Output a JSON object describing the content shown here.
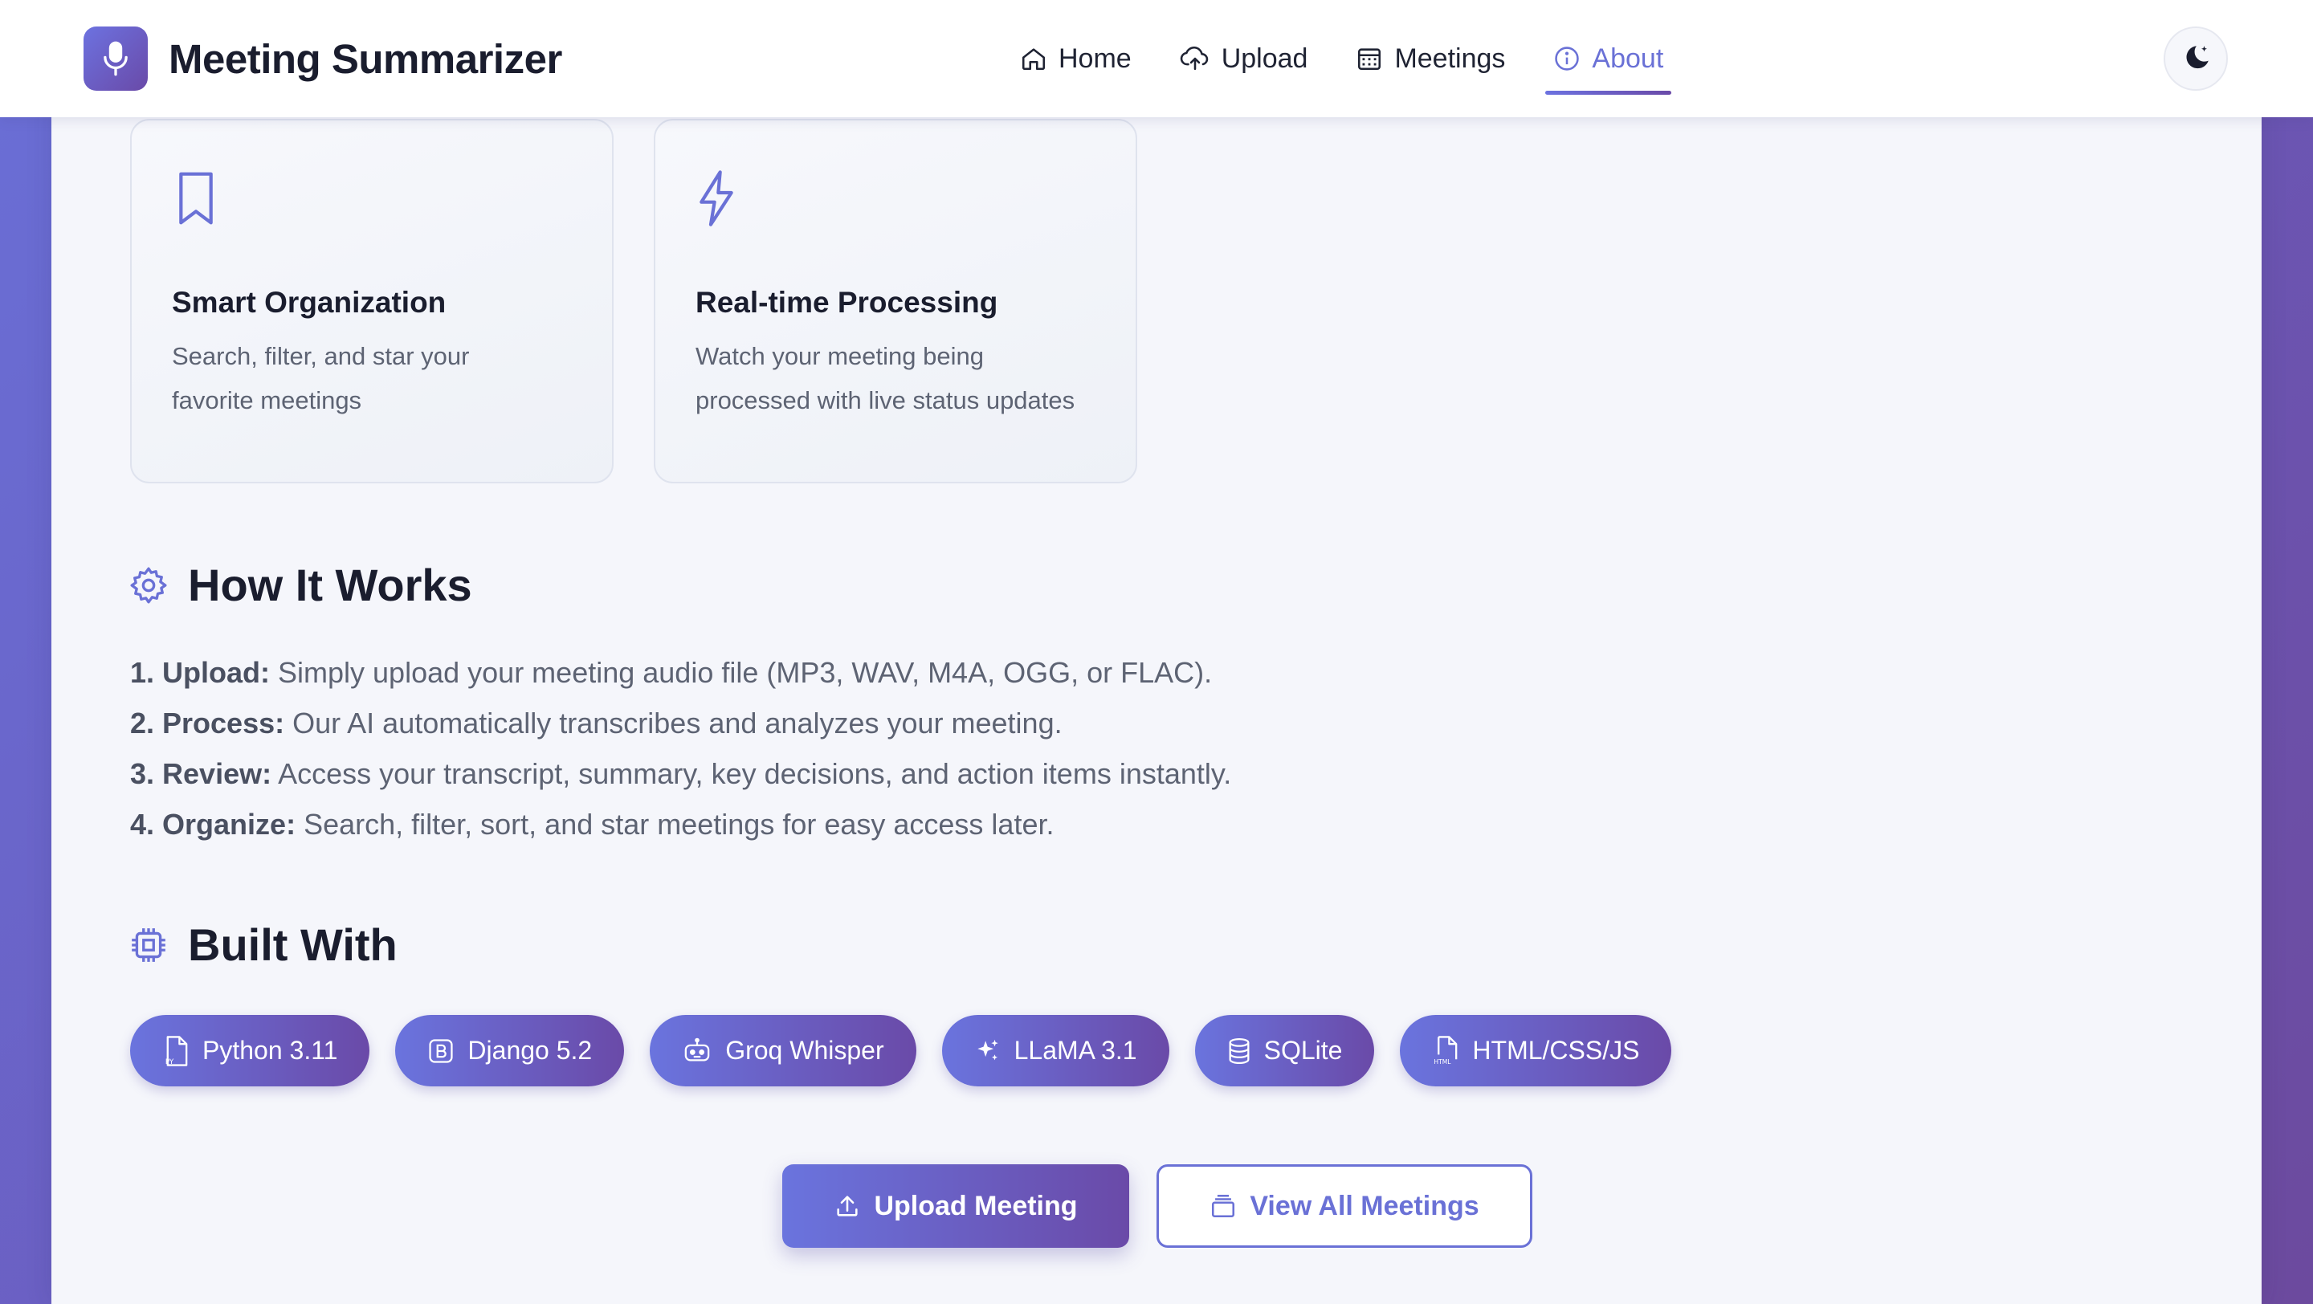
{
  "app": {
    "title": "Meeting Summarizer"
  },
  "nav": {
    "items": [
      {
        "label": "Home",
        "icon": "home-icon"
      },
      {
        "label": "Upload",
        "icon": "cloud-upload-icon"
      },
      {
        "label": "Meetings",
        "icon": "calendar-icon"
      },
      {
        "label": "About",
        "icon": "info-icon",
        "active": true
      }
    ],
    "theme_toggle_icon": "moon-stars-icon"
  },
  "features": [
    {
      "icon": "bookmark-icon",
      "title": "Smart Organization",
      "description": "Search, filter, and star your favorite meetings"
    },
    {
      "icon": "lightning-icon",
      "title": "Real-time Processing",
      "description": "Watch your meeting being processed with live status updates"
    }
  ],
  "how_it_works": {
    "title": "How It Works",
    "icon": "gear-icon",
    "steps": [
      {
        "label": "1. Upload:",
        "text": " Simply upload your meeting audio file (MP3, WAV, M4A, OGG, or FLAC)."
      },
      {
        "label": "2. Process:",
        "text": " Our AI automatically transcribes and analyzes your meeting."
      },
      {
        "label": "3. Review:",
        "text": " Access your transcript, summary, key decisions, and action items instantly."
      },
      {
        "label": "4. Organize:",
        "text": " Search, filter, sort, and star meetings for easy access later."
      }
    ]
  },
  "built_with": {
    "title": "Built With",
    "icon": "cpu-icon",
    "items": [
      {
        "label": "Python 3.11",
        "icon": "python-file-icon"
      },
      {
        "label": "Django 5.2",
        "icon": "bootstrap-icon"
      },
      {
        "label": "Groq Whisper",
        "icon": "robot-icon"
      },
      {
        "label": "LLaMA 3.1",
        "icon": "sparkles-icon"
      },
      {
        "label": "SQLite",
        "icon": "database-icon"
      },
      {
        "label": "HTML/CSS/JS",
        "icon": "html-file-icon"
      }
    ]
  },
  "actions": {
    "upload_label": "Upload Meeting",
    "view_all_label": "View All Meetings"
  },
  "colors": {
    "accent": "#6a71d6",
    "accent_dark": "#6a4aa8",
    "text": "#1a1d2e",
    "muted": "#5d6373"
  }
}
